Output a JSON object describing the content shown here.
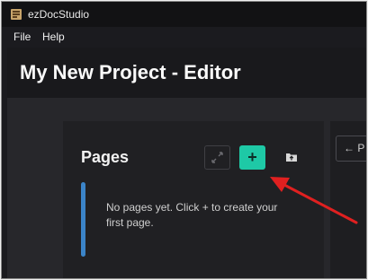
{
  "window": {
    "title": "ezDocStudio",
    "app_icon": "ezdocstudio-app-icon"
  },
  "menubar": {
    "items": [
      {
        "label": "File"
      },
      {
        "label": "Help"
      }
    ]
  },
  "editor": {
    "title": "My New Project - Editor"
  },
  "pages_panel": {
    "title": "Pages",
    "expand_icon": "expand-arrows-icon",
    "add_label": "+",
    "folder_icon": "folder-upload-icon",
    "empty_message": "No pages yet. Click + to create your first page."
  },
  "right_panel": {
    "prev_button_label": "P",
    "prev_icon": "arrow-left-icon"
  },
  "colors": {
    "accent": "#1ec9a6",
    "info_bar": "#3b84c8",
    "annotation_arrow": "#e02020"
  }
}
